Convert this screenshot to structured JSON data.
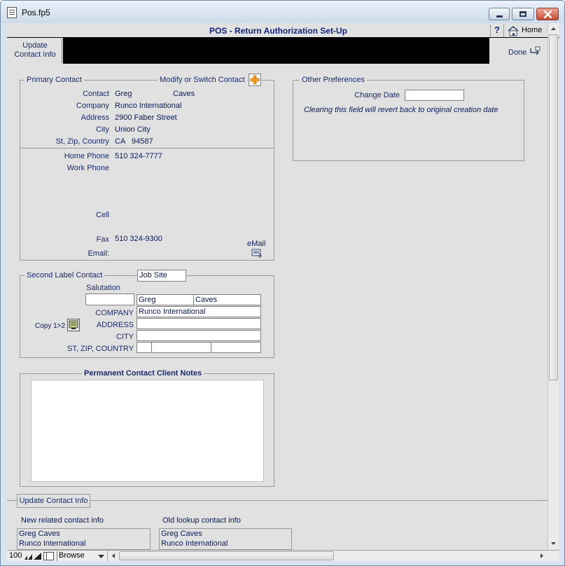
{
  "window": {
    "title": "Pos.fp5"
  },
  "header": {
    "title": "POS - Return Authorization Set-Up",
    "help_label": "?",
    "home_label": "Home"
  },
  "toolbar": {
    "update_label_1": "Update",
    "update_label_2": "Contact Info",
    "done_label": "Done"
  },
  "primary": {
    "legend": "Primary Contact",
    "modify_label": "Modify or Switch Contact",
    "labels": {
      "contact": "Contact",
      "company": "Company",
      "address": "Address",
      "city": "City",
      "stzip": "St, Zip, Country",
      "home_phone": "Home Phone",
      "work_phone": "Work Phone",
      "cell": "Cell",
      "fax": "Fax",
      "email": "Email:",
      "email_btn": "eMail"
    },
    "values": {
      "first": "Greg",
      "last": "Caves",
      "company": "Runco International",
      "address": "2900 Faber Street",
      "city": "Union City",
      "state": "CA",
      "zip": "94587",
      "home_phone": "510 324-7777",
      "fax": "510 324-9300"
    }
  },
  "prefs": {
    "legend": "Other Preferences",
    "change_date_label": "Change Date",
    "change_date_value": "",
    "note": "Clearing this field will revert back to original creation date"
  },
  "second": {
    "legend": "Second Label Contact",
    "job_site": "Job Site",
    "salutation_label": "Salutation",
    "salutation_value": "",
    "first": "Greg",
    "last": "Caves",
    "company_label": "COMPANY",
    "company": "Runco International",
    "address_label": "ADDRESS",
    "address": "",
    "city_label": "CITY",
    "city": "",
    "stzip_label": "ST, ZIP, COUNTRY",
    "copy_label": "Copy 1>2"
  },
  "notes": {
    "legend": "Permanent Contact Client Notes",
    "text": ""
  },
  "update_section": {
    "button_label": "Update Contact Info",
    "new_label": "New related contact info",
    "old_label": "Old lookup contact info",
    "new_lines": [
      "Greg Caves",
      "Runco International"
    ],
    "old_lines": [
      "Greg Caves",
      "Runco International"
    ]
  },
  "statusbar": {
    "zoom": "100",
    "mode": "Browse"
  }
}
